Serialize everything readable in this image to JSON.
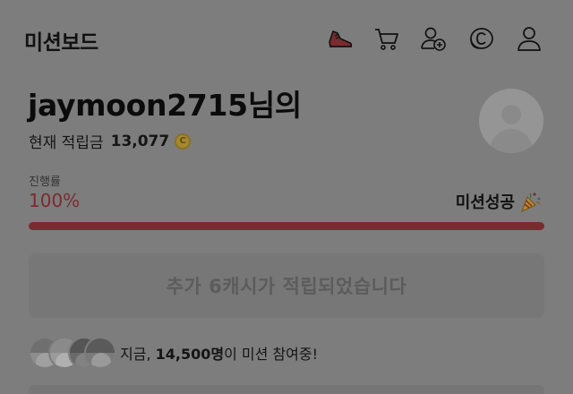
{
  "header": {
    "title": "미션보드",
    "icons": [
      "sneaker-icon",
      "cart-icon",
      "add-friend-icon",
      "cash-coin-icon",
      "profile-icon"
    ]
  },
  "user": {
    "name": "jaymoon2715",
    "name_suffix": "님의",
    "balance_label": "현재 적립금",
    "balance_value": "13,077",
    "coin_symbol": "C"
  },
  "progress": {
    "label": "진행률",
    "percent_text": "100%",
    "value": 1.0,
    "status_text": "미션성공",
    "status_icon": "party-popper-icon",
    "fill_color": "#7a2b30"
  },
  "reward_button": {
    "label": "추가 6캐시가 적립되었습니다"
  },
  "participants": {
    "prefix": "지금, ",
    "count": "14,500명",
    "suffix": "이 미션 참여중!"
  }
}
